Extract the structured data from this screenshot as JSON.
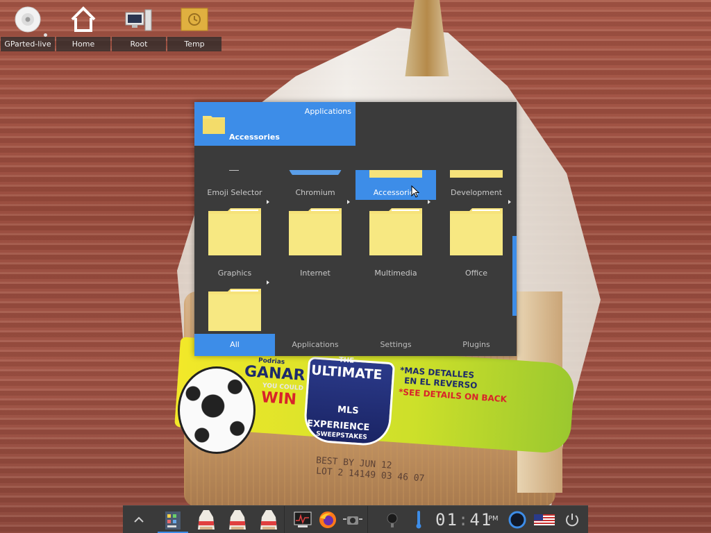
{
  "desktop": {
    "icons": [
      {
        "name": "desktop-icon-gparted-live",
        "label": "GParted-live"
      },
      {
        "name": "desktop-icon-home",
        "label": "Home"
      },
      {
        "name": "desktop-icon-root",
        "label": "Root"
      },
      {
        "name": "desktop-icon-temp",
        "label": "Temp"
      }
    ]
  },
  "wallpaper": {
    "promo": {
      "podrias": "Podrias",
      "ganar": "GANAR",
      "you_could": "YOU COULD",
      "win": "WIN",
      "the": "THE",
      "ultimate": "ULTIMATE",
      "mls": "MLS",
      "experience": "EXPERIENCE",
      "sweepstakes": "SWEEPSTAKES",
      "mas_detalles": "*MAS DETALLES",
      "en_el_reverso": "EN EL REVERSO",
      "see_details": "*SEE DETAILS ON BACK"
    },
    "print_line1": "BEST BY  JUN 12",
    "print_line2": "LOT   2 14149 03 46 07"
  },
  "launcher": {
    "breadcrumb": {
      "parent": "Applications",
      "current": "Accessories"
    },
    "items": [
      {
        "label": "Emoji Selector",
        "icon": "emoji-icon",
        "submenu": false,
        "selected": false
      },
      {
        "label": "Chromium",
        "icon": "chromium-icon",
        "submenu": false,
        "selected": false
      },
      {
        "label": "Accessories",
        "icon": "folder-icon",
        "submenu": false,
        "selected": true
      },
      {
        "label": "Development",
        "icon": "folder-icon",
        "submenu": false,
        "selected": false
      },
      {
        "label": "Graphics",
        "icon": "folder-icon",
        "submenu": true,
        "selected": false
      },
      {
        "label": "Internet",
        "icon": "folder-icon",
        "submenu": true,
        "selected": false
      },
      {
        "label": "Multimedia",
        "icon": "folder-icon",
        "submenu": true,
        "selected": false
      },
      {
        "label": "Office",
        "icon": "folder-icon",
        "submenu": true,
        "selected": false
      },
      {
        "label": "",
        "icon": "folder-icon",
        "submenu": true,
        "selected": false
      }
    ],
    "tabs": [
      {
        "label": "All",
        "active": true
      },
      {
        "label": "Applications",
        "active": false
      },
      {
        "label": "Settings",
        "active": false
      },
      {
        "label": "Plugins",
        "active": false
      }
    ]
  },
  "taskbar": {
    "clock": {
      "hours": "01",
      "minutes": "41",
      "ampm": "PM"
    },
    "items": [
      "show-desktop-button",
      "launcher-button",
      "bread-window-1",
      "bread-window-2",
      "bread-window-3",
      "system-monitor-icon",
      "firefox-icon",
      "screenshot-icon",
      "volume-icon",
      "temperature-icon",
      "clock",
      "network-icon",
      "keyboard-layout-flag-us",
      "power-button"
    ]
  },
  "colors": {
    "accent": "#3d8de8",
    "panel": "#3b3b3b",
    "folder": "#f6e27a"
  }
}
